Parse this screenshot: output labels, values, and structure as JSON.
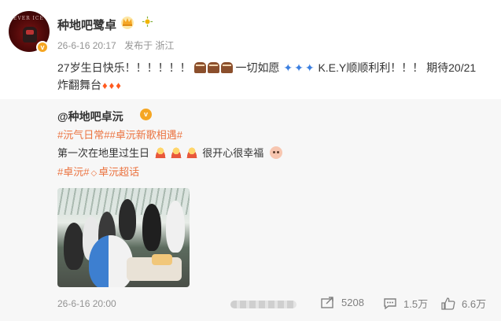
{
  "post": {
    "author": "种地吧鹭卓",
    "timestamp": "26-6-16 20:17",
    "source": "发布于 浙江",
    "text_part1": "27岁生日快乐！！！！！！",
    "text_part2": "一切如愿",
    "text_part3": "K.E.Y顺顺利利！！！ 期待20/21炸翻舞台",
    "avatar_text": "EVER ICE"
  },
  "repost": {
    "author": "@种地吧卓沅",
    "tags_line1": [
      "#沅气日常#",
      "#卓沅新歌相遇#"
    ],
    "text": "第一次在地里过生日",
    "text_after": "很开心很幸福",
    "tag_line2_a": "#卓沅#",
    "tag_line2_b": "卓沅超话",
    "timestamp": "26-6-16 20:00"
  },
  "actions": {
    "share_count": "5208",
    "comment_count": "1.5万",
    "like_count": "6.6万"
  },
  "colors": {
    "tag": "#eb7340",
    "badge": "#f5a623",
    "repost_bg": "#f7f7f7",
    "meta_gray": "#939393"
  },
  "icons": [
    "crown-icon",
    "sun-icon",
    "share-icon",
    "comment-icon",
    "like-icon",
    "verified-badge-icon"
  ]
}
